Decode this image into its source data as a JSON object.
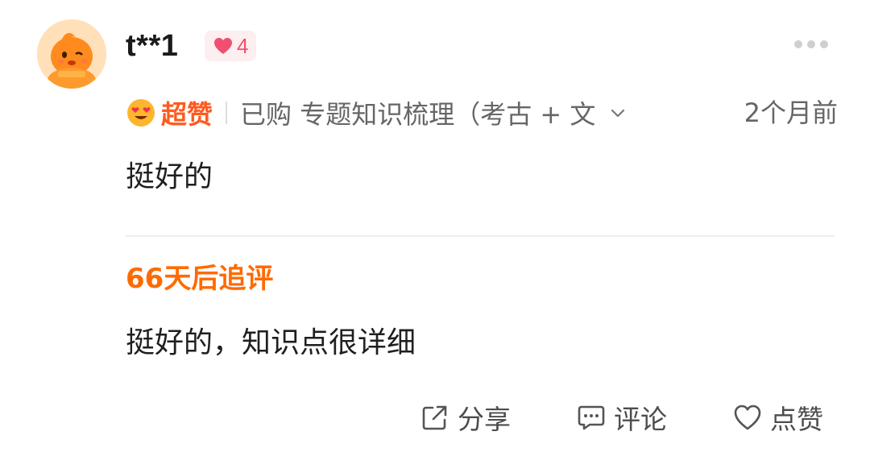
{
  "review": {
    "username": "t**1",
    "like_count": "4",
    "rating_label": "超赞",
    "purchase_info": "已购 专题知识梳理（考古 + 文",
    "time_ago": "2个月前",
    "content": "挺好的",
    "followup": {
      "title": "66天后追评",
      "content": "挺好的，知识点很详细"
    },
    "actions": {
      "share": "分享",
      "comment": "评论",
      "like": "点赞"
    }
  },
  "colors": {
    "accent_orange": "#ff6a00",
    "rating_orange": "#ff5a1f",
    "like_pink": "#f0506e",
    "muted_text": "#666666"
  },
  "icons": {
    "avatar": "orange-mascot-avatar",
    "badge": "heart-icon",
    "rating": "heart-eyes-emoji-icon",
    "expand": "chevron-down-icon",
    "more": "more-dots-icon",
    "share": "share-icon",
    "comment": "comment-icon",
    "like": "heart-outline-icon"
  }
}
